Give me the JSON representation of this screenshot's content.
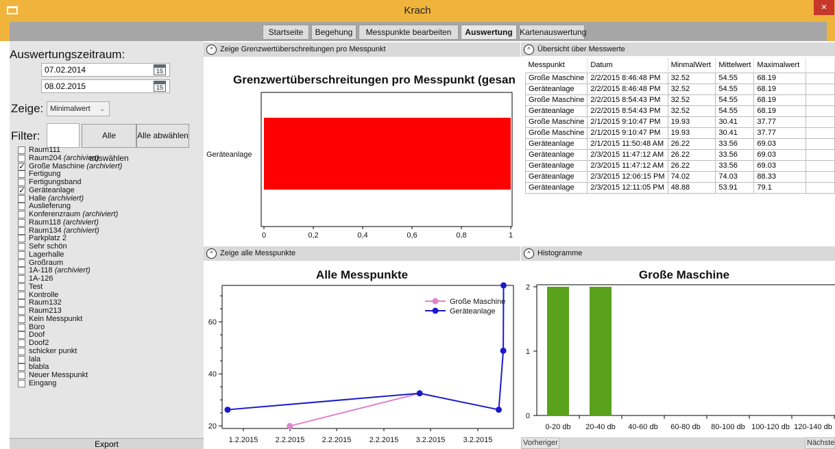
{
  "window": {
    "title": "Krach",
    "close_label": "×"
  },
  "nav": [
    {
      "label": "Startseite",
      "active": false
    },
    {
      "label": "Begehung",
      "active": false
    },
    {
      "label": "Messpunkte bearbeiten",
      "active": false
    },
    {
      "label": "Auswertung",
      "active": true
    },
    {
      "label": "Kartenauswertung",
      "active": false
    }
  ],
  "left": {
    "range_label": "Auswertungszeitraum:",
    "date_from": "07.02.2014",
    "date_to": "08.02.2015",
    "calendar_day": "15",
    "show_label": "Zeige:",
    "show_value": "Minimalwert",
    "filter_label": "Filter:",
    "filter_value": "",
    "select_all": "Alle auswählen",
    "deselect_all": "Alle abwählen",
    "items": [
      {
        "label": "Raum111",
        "sub": "",
        "checked": false
      },
      {
        "label": "Raum204",
        "sub": "(archiviert)",
        "checked": false
      },
      {
        "label": "Große Maschine",
        "sub": "(archiviert)",
        "checked": true
      },
      {
        "label": "Fertigung",
        "sub": "",
        "checked": false
      },
      {
        "label": "Fertigungsband",
        "sub": "",
        "checked": false
      },
      {
        "label": "Geräteanlage",
        "sub": "",
        "checked": true
      },
      {
        "label": "Halle",
        "sub": "(archiviert)",
        "checked": false
      },
      {
        "label": "Auslieferung",
        "sub": "",
        "checked": false
      },
      {
        "label": "Konferenzraum",
        "sub": "(archiviert)",
        "checked": false
      },
      {
        "label": "Raum118",
        "sub": "(archiviert)",
        "checked": false
      },
      {
        "label": "Raum134",
        "sub": "(archiviert)",
        "checked": false
      },
      {
        "label": "Parkplatz 2",
        "sub": "",
        "checked": false
      },
      {
        "label": "Sehr schön",
        "sub": "",
        "checked": false
      },
      {
        "label": "Lagerhalle",
        "sub": "",
        "checked": false
      },
      {
        "label": "Großraum",
        "sub": "",
        "checked": false
      },
      {
        "label": "1A-118",
        "sub": "(archiviert)",
        "checked": false
      },
      {
        "label": "1A-126",
        "sub": "",
        "checked": false
      },
      {
        "label": "Test",
        "sub": "",
        "checked": false
      },
      {
        "label": "Kontrolle",
        "sub": "",
        "checked": false
      },
      {
        "label": "Raum132",
        "sub": "",
        "checked": false
      },
      {
        "label": "Raum213",
        "sub": "",
        "checked": false
      },
      {
        "label": "Kein Messpunkt",
        "sub": "",
        "checked": false
      },
      {
        "label": "Büro",
        "sub": "",
        "checked": false
      },
      {
        "label": "Doof",
        "sub": "",
        "checked": false
      },
      {
        "label": "Doof2",
        "sub": "",
        "checked": false
      },
      {
        "label": "schicker punkt",
        "sub": "",
        "checked": false
      },
      {
        "label": "lala",
        "sub": "",
        "checked": false
      },
      {
        "label": "blabla",
        "sub": "",
        "checked": false
      },
      {
        "label": "Neuer Messpunkt",
        "sub": "",
        "checked": false
      },
      {
        "label": "Eingang",
        "sub": "",
        "checked": false
      }
    ],
    "export": "Export"
  },
  "sections": {
    "exceed": "Zeige Grenzwertüberschreitungen pro Messpunkt",
    "overview": "Übersicht über Messwerte",
    "all": "Zeige alle Messpunkte",
    "hist": "Histogramme",
    "toggle_icon": "^"
  },
  "table": {
    "headers": [
      "Messpunkt",
      "Datum",
      "MinmalWert",
      "Mittelwert",
      "Maximalwert"
    ],
    "rows": [
      [
        "Große Maschine",
        "2/2/2015 8:46:48 PM",
        "32.52",
        "54.55",
        "68.19"
      ],
      [
        "Geräteanlage",
        "2/2/2015 8:46:48 PM",
        "32.52",
        "54.55",
        "68.19"
      ],
      [
        "Große Maschine",
        "2/2/2015 8:54:43 PM",
        "32.52",
        "54.55",
        "68.19"
      ],
      [
        "Geräteanlage",
        "2/2/2015 8:54:43 PM",
        "32.52",
        "54.55",
        "68.19"
      ],
      [
        "Große Maschine",
        "2/1/2015 9:10:47 PM",
        "19.93",
        "30.41",
        "37.77"
      ],
      [
        "Große Maschine",
        "2/1/2015 9:10:47 PM",
        "19.93",
        "30.41",
        "37.77"
      ],
      [
        "Geräteanlage",
        "2/1/2015 11:50:48 AM",
        "26.22",
        "33.56",
        "69.03"
      ],
      [
        "Geräteanlage",
        "2/3/2015 11:47:12 AM",
        "26.22",
        "33.56",
        "69.03"
      ],
      [
        "Geräteanlage",
        "2/3/2015 11:47:12 AM",
        "26.22",
        "33.56",
        "69.03"
      ],
      [
        "Geräteanlage",
        "2/3/2015 12:06:15 PM",
        "74.02",
        "74.03",
        "88.33"
      ],
      [
        "Geräteanlage",
        "2/3/2015 12:11:05 PM",
        "48.88",
        "53.91",
        "79.1"
      ]
    ]
  },
  "pager": {
    "prev": "Vorheriger",
    "next": "Nächster"
  },
  "chart_data": [
    {
      "type": "bar",
      "orientation": "horizontal",
      "title": "Grenzwertüberschreitungen pro Messpunkt (gesan",
      "categories": [
        "Geräteanlage"
      ],
      "values": [
        1
      ],
      "xlim": [
        0,
        1
      ],
      "xticks": [
        "0",
        "0,2",
        "0,4",
        "0,6",
        "0,8",
        "1"
      ],
      "color": "#ff0000"
    },
    {
      "type": "line",
      "title": "Alle Messpunkte",
      "xticks": [
        "1.2.2015",
        "2.2.2015",
        "2.2.2015",
        "2.2.2015",
        "3.2.2015",
        "3.2.2015"
      ],
      "yticks": [
        "20",
        "40",
        "60"
      ],
      "ylim": [
        19,
        74
      ],
      "legend_position": "top-right",
      "series": [
        {
          "name": "Große Maschine",
          "color": "#e083cf",
          "x": [
            0.22,
            0.68
          ],
          "y": [
            19.93,
            32.52
          ]
        },
        {
          "name": "Geräteanlage",
          "color": "#1a1acc",
          "x": [
            0.0,
            0.68,
            0.96,
            0.976,
            0.977
          ],
          "y": [
            26.22,
            32.52,
            26.22,
            48.88,
            74.02
          ]
        }
      ]
    },
    {
      "type": "bar",
      "title": "Große Maschine",
      "categories": [
        "0-20 db",
        "20-40 db",
        "40-60 db",
        "60-80 db",
        "80-100 db",
        "100-120 db",
        "120-140 db"
      ],
      "values": [
        2,
        2,
        0,
        0,
        0,
        0,
        0
      ],
      "ylim": [
        0,
        2
      ],
      "yticks": [
        "0",
        "1",
        "2"
      ],
      "color": "#5aa11c"
    }
  ]
}
